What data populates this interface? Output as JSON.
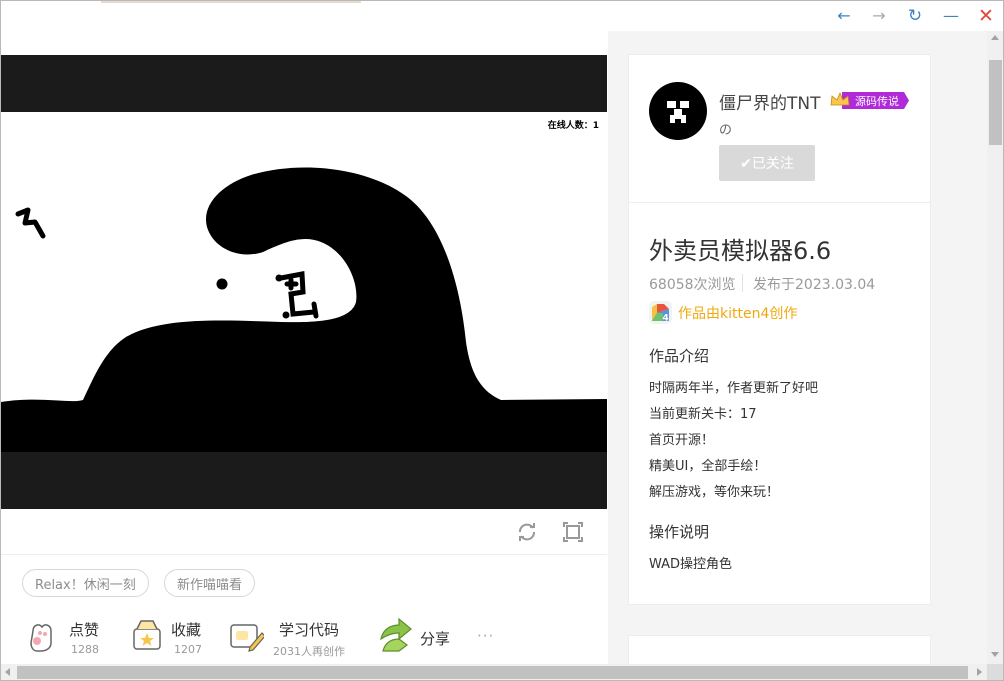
{
  "window": {
    "back_icon": "←",
    "forward_icon": "→",
    "refresh_icon": "↻",
    "minimize_icon": "—",
    "close_icon": "✕"
  },
  "stage": {
    "online_count": "在线人数：1"
  },
  "tags": [
    "Relax！休闲一刻",
    "新作喵喵看"
  ],
  "actions": {
    "like": {
      "label": "点赞",
      "count": "1288"
    },
    "favorite": {
      "label": "收藏",
      "count": "1207"
    },
    "learn_code": {
      "label": "学习代码",
      "count": "2031人再创作"
    },
    "share": {
      "label": "分享"
    },
    "more": "···"
  },
  "author": {
    "name": "僵尸界的TNT",
    "badge": "源码传说",
    "sub": "の",
    "follow_label": "✔已关注"
  },
  "work": {
    "title": "外卖员模拟器6.6",
    "views": "68058次浏览",
    "published": "发布于2023.03.04",
    "made_with": "作品由kitten4创作"
  },
  "intro": {
    "title": "作品介绍",
    "lines": [
      "时隔两年半，作者更新了好吧",
      "当前更新关卡：17",
      "首页开源！",
      "精美UI，全部手绘！",
      "解压游戏，等你来玩！"
    ]
  },
  "operation": {
    "title": "操作说明",
    "text": "WAD操控角色"
  },
  "colors": {
    "accent_blue": "#3d83c6",
    "close_red": "#e0483a",
    "kitten_orange": "#f0a80e",
    "badge_purple": "#b02ad8"
  }
}
